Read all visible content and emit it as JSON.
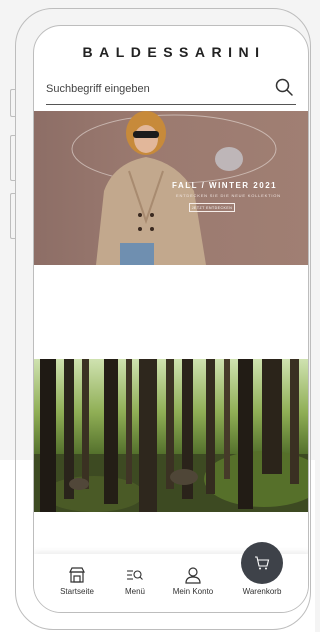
{
  "header": {
    "logo_text": "BALDESSARINI"
  },
  "search": {
    "placeholder": "Suchbegriff eingeben",
    "icon": "search-icon"
  },
  "hero": {
    "title": "FALL / WINTER 2021",
    "subtitle": "ENTDECKEN SIE DIE NEUE KOLLEKTION",
    "button_label": "JETZT ENTDECKEN"
  },
  "tabbar": {
    "items": [
      {
        "label": "Startseite",
        "icon": "store-icon"
      },
      {
        "label": "Menü",
        "icon": "menu-search-icon"
      },
      {
        "label": "Mein Konto",
        "icon": "user-icon"
      },
      {
        "label": "Warenkorb",
        "icon": "cart-icon"
      }
    ]
  },
  "colors": {
    "accent": "#3e4249",
    "text": "#222222",
    "frame": "#bdbdbd"
  }
}
